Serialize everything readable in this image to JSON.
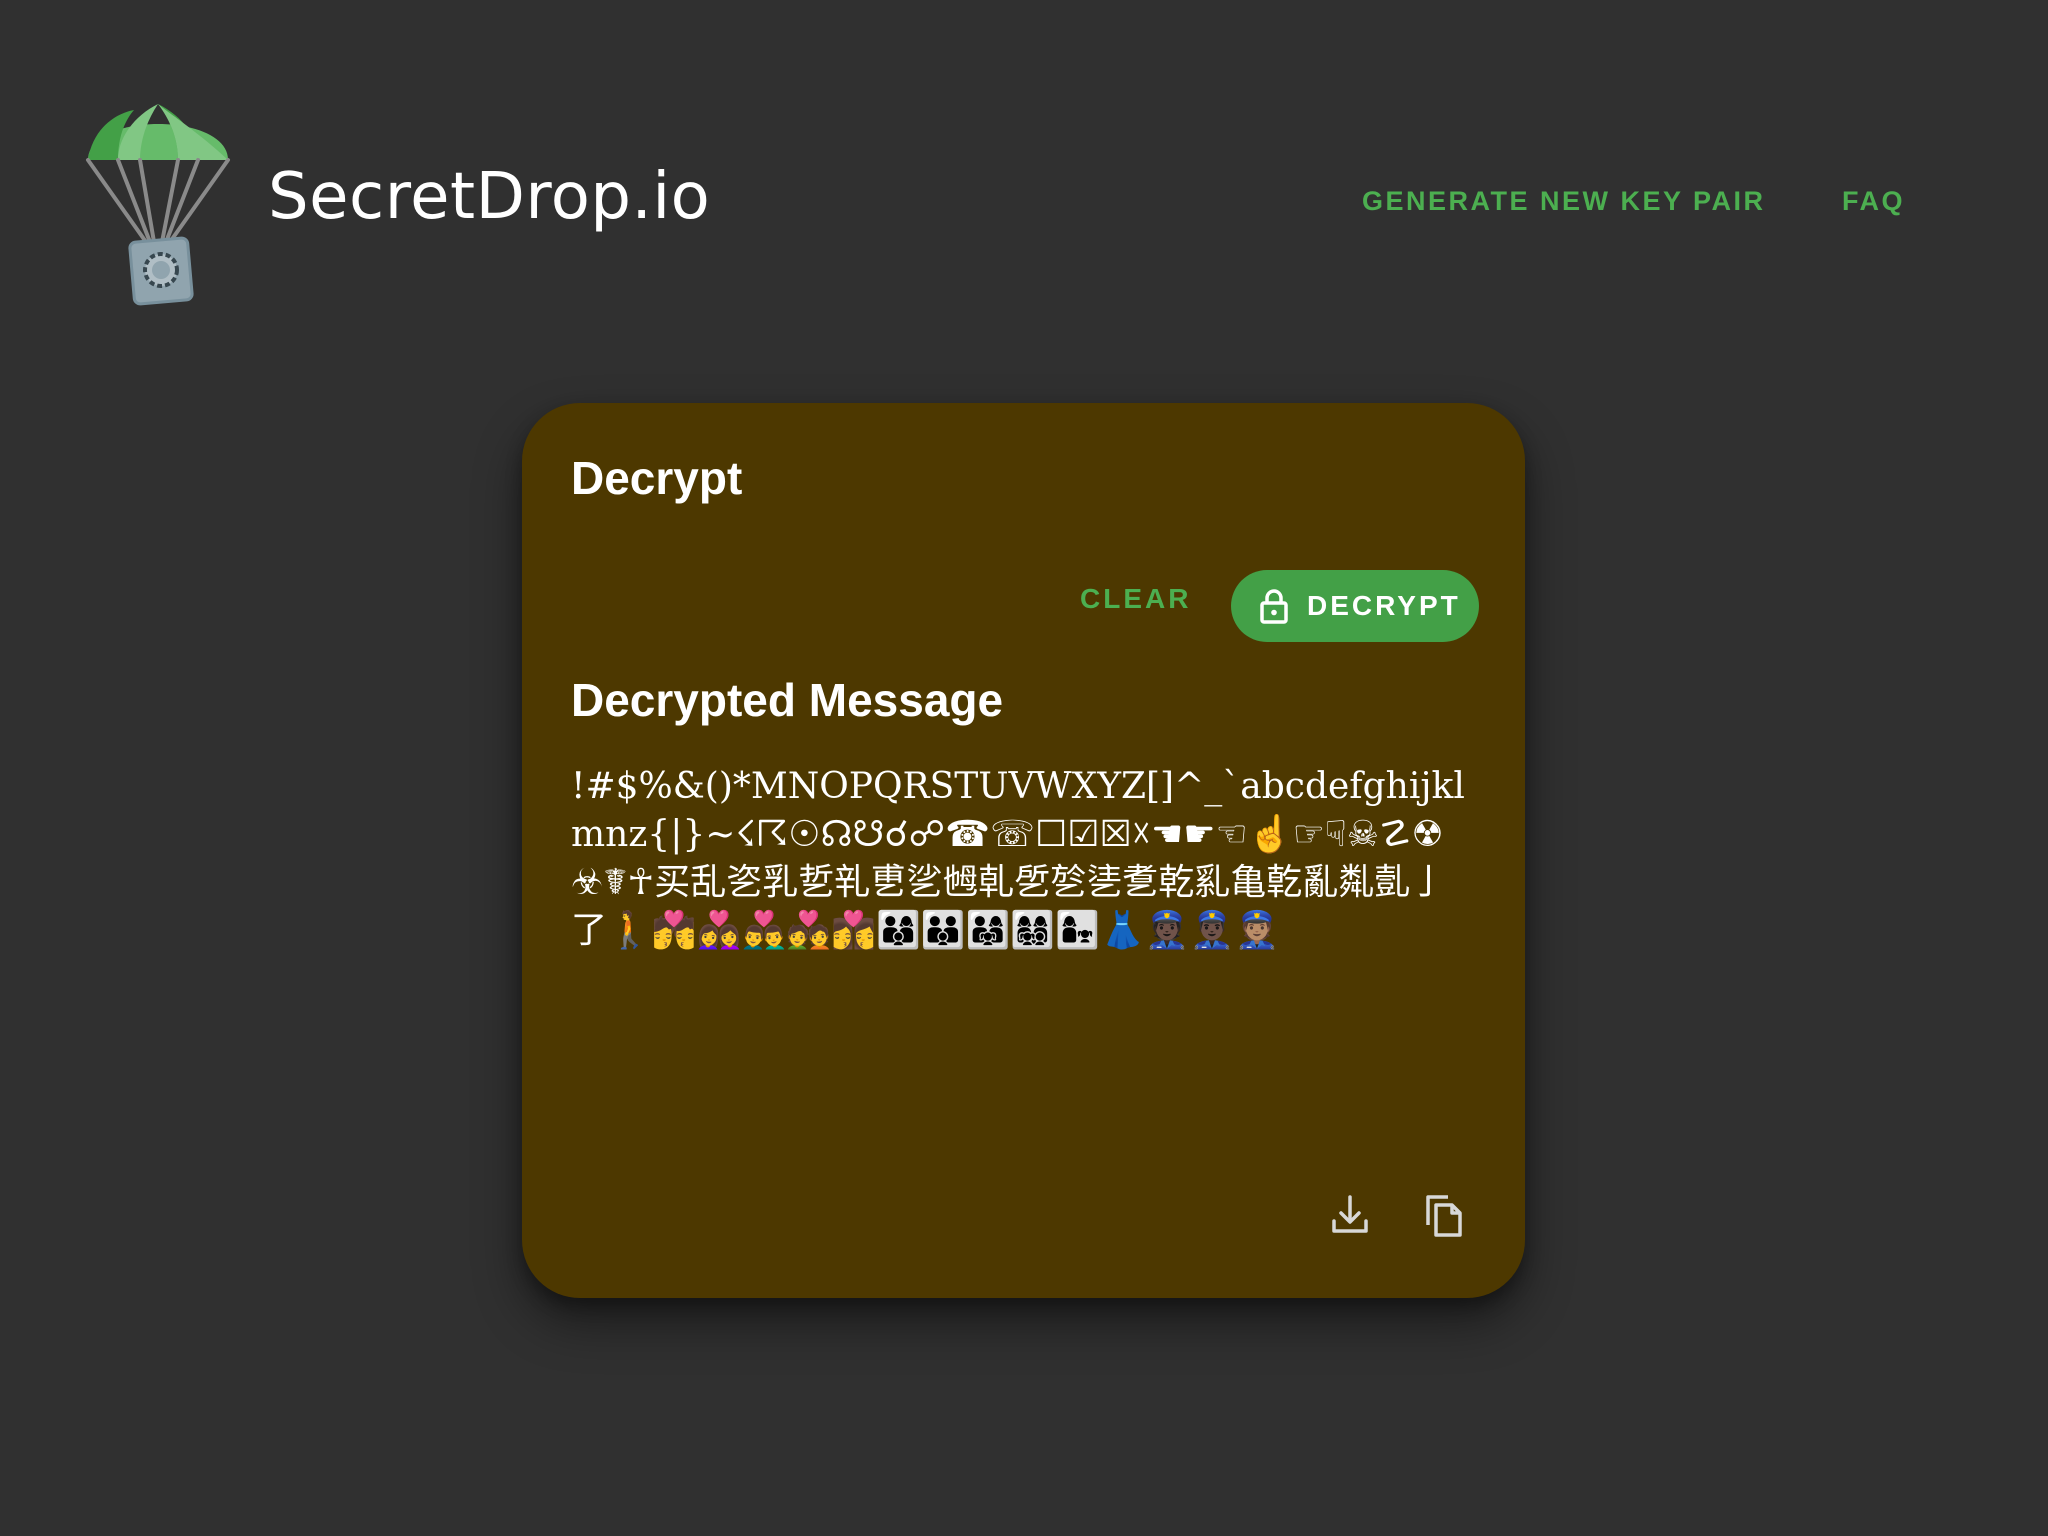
{
  "header": {
    "brand": "SecretDrop.io",
    "logo_icon": "parachute-safe-icon",
    "nav": {
      "generate_label": "GENERATE NEW KEY PAIR",
      "faq_label": "FAQ"
    }
  },
  "card": {
    "title": "Decrypt",
    "clear_label": "CLEAR",
    "decrypt_label": "DECRYPT",
    "decrypt_icon": "lock-icon",
    "result_title": "Decrypted Message",
    "message": "!#$%&()*MNOPQRSTUVWXYZ[]^_`abcdefghijklmnz{|}~☇☈☉☊☋☌☍☎☏☐☑☒☓☚☛☜☝☞☟☠☡☢☣☤☥买乱乲乳乴乵乶乷乸乹乺乻乼乽乾乿亀亁亂亃亄亅了🚶💏👩‍❤️‍👩👨‍❤️‍👨💑👩‍❤️‍💋‍👩👨‍👩‍👦👪👨‍👩‍👧👩‍👩‍👧‍👦👩‍👧👗👮🏿👮🏿‍♂️👮🏽",
    "download_icon": "download-icon",
    "copy_icon": "copy-icon"
  },
  "colors": {
    "background": "#303030",
    "card": "#4d3800",
    "accent": "#4caf50",
    "button": "#43a047"
  }
}
